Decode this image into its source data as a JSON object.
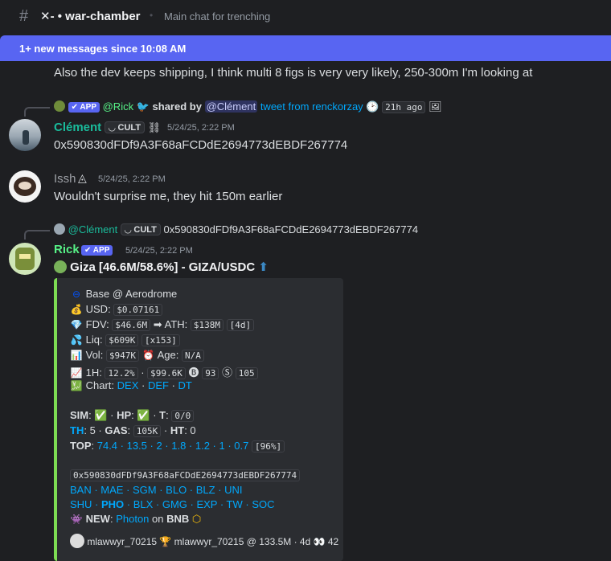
{
  "header": {
    "channel": "✕- • war-chamber",
    "topic": "Main chat for trenching"
  },
  "new_messages_bar": "1+ new messages since 10:08 AM",
  "continuation_text": "Also the dev keeps shipping, I think multi 8 figs is very very likely, 250-300m I'm looking at",
  "reply1": {
    "app_label": "APP",
    "author": "@Rick",
    "shared_by": "shared by",
    "mention": "@Clément",
    "tweet": "tweet from renckorzay",
    "ago": "21h ago"
  },
  "msg_clement": {
    "author": "Clément",
    "tag": "CULT",
    "time": "5/24/25, 2:22 PM",
    "text": "0x590830dFDf9A3F68aFCDdE2694773dEBDF267774"
  },
  "msg_issh": {
    "author": "Issh",
    "time": "5/24/25, 2:22 PM",
    "text": "Wouldn't surprise me, they hit 150m earlier"
  },
  "reply2": {
    "mention": "@Clément",
    "tag": "CULT",
    "text": "0x590830dFDf9A3F68aFCDdE2694773dEBDF267774"
  },
  "msg_rick": {
    "author": "Rick",
    "app_label": "APP",
    "time": "5/24/25, 2:22 PM",
    "title": "Giza [46.6M/58.6%] - GIZA/USDC",
    "embed": {
      "chain": "Base @ Aerodrome",
      "usd_label": "USD:",
      "usd": "$0.07161",
      "fdv_label": "FDV:",
      "fdv": "$46.6M",
      "ath_label": "ATH:",
      "ath": "$138M",
      "ath_age": "[4d]",
      "liq_label": "Liq:",
      "liq": "$609K",
      "liq_mult": "[x153]",
      "vol_label": "Vol:",
      "vol": "$947K",
      "age_label": "Age:",
      "age": "N/A",
      "h1_label": "1H:",
      "h1_pct": "12.2%",
      "h1_vol": "$99.6K",
      "buys": "93",
      "sells": "105",
      "chart_label": "Chart:",
      "chart_links": [
        "DEX",
        "DEF",
        "DT"
      ],
      "sim_label": "SIM",
      "hp_label": "HP",
      "t_label": "T",
      "t_value": "0/0",
      "th_label": "TH",
      "th_value": "5",
      "gas_label": "GAS",
      "gas_value": "105K",
      "ht_label": "HT",
      "ht_value": "0",
      "top_label": "TOP",
      "top_values": "74.4 · 13.5 · 2 · 1.8 · 1.2 · 1 · 0.7",
      "top_total": "[96%]",
      "address": "0x590830dFDf9A3F68aFCDdE2694773dEBDF267774",
      "links_row1": "BAN · MAE · SGM · BLO · BLZ · UNI",
      "links_row2_a": "SHU · ",
      "links_row2_b": "PHO",
      "links_row2_c": " · BLX · GMG · EXP · TW · SOC",
      "new_label": "NEW",
      "new_link": "Photon",
      "new_on": "on",
      "new_chain": "BNB",
      "footer": "mlawwyr_70215 🏆 mlawwyr_70215 @ 133.5M · 4d 👀 42"
    }
  }
}
